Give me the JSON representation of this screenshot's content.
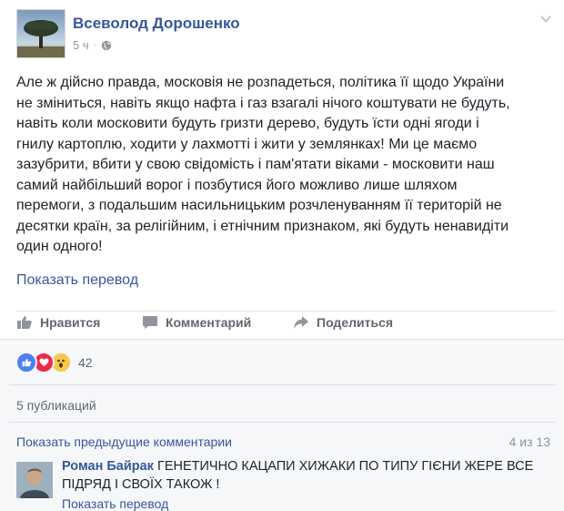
{
  "post": {
    "author": "Всеволод Дорошенко",
    "time": "5 ч",
    "separator": "·",
    "text_lines": [
      "Але ж дійсно правда, московія не розпадеться, політика її щодо України",
      "не зміниться, навіть якщо нафта і газ взагалі нічого коштувати не будуть,",
      "навіть коли московити будуть гризти дерево, будуть їсти одні ягоди і",
      "гнилу картоплю, ходити у лахмотті і жити у землянках! Ми це маємо",
      "зазубрити, вбити у свою свідомість і пам'ятати віками - московити наш",
      "самий найбільший ворог і позбутися його можливо лише шляхом",
      "перемоги, з подальшим насильницьким розчленуванням її територій не",
      "десятки країн, за релігійним, і етнічним признаком, які будуть ненавидіти",
      "один одного!"
    ],
    "translate_label": "Показать перевод"
  },
  "actions": {
    "like": "Нравится",
    "comment": "Комментарий",
    "share": "Поделиться"
  },
  "feedback": {
    "reaction_count": "42",
    "shares": "5 публикаций",
    "previous_comments": "Показать предыдущие комментарии",
    "comment_count": "4 из 13"
  },
  "comment": {
    "author": "Роман Байрак",
    "text": "ГЕНЕТИЧНО КАЦАПИ ХИЖАКИ ПО ТИПУ ГІЄНИ ЖЕРЕ ВСЕ ПІДРЯД І СВОЇХ ТАКОЖ !",
    "translate_label": "Показать перевод"
  },
  "icons": [
    "chevron-down-icon",
    "globe-icon",
    "like-icon",
    "comment-icon",
    "share-icon",
    "like-reaction-icon",
    "love-reaction-icon",
    "wow-reaction-icon"
  ],
  "colors": {
    "link": "#365899",
    "secondary": "#616770",
    "muted": "#90949c",
    "like": "#4d7ff0",
    "love": "#f0284a",
    "wow": "#f7c84c"
  }
}
